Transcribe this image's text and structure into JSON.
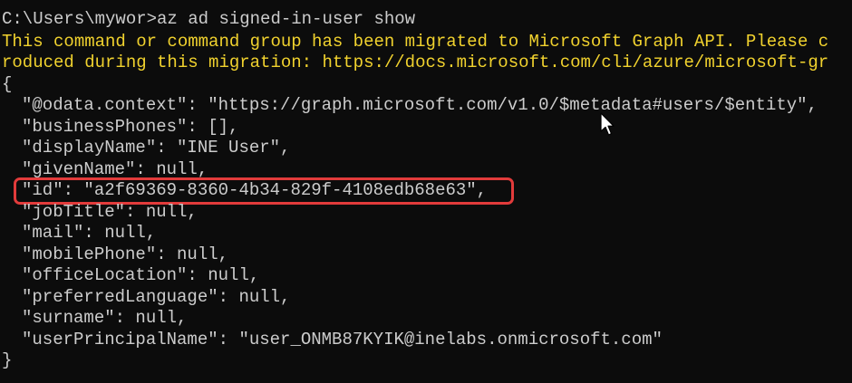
{
  "terminal": {
    "prompt_line": "C:\\Users\\mywor>az ad signed-in-user show",
    "warning_line_1": "This command or command group has been migrated to Microsoft Graph API. Please c",
    "warning_line_2": "roduced during this migration: https://docs.microsoft.com/cli/azure/microsoft-gr",
    "json_open": "{",
    "json_lines": [
      "\"@odata.context\": \"https://graph.microsoft.com/v1.0/$metadata#users/$entity\",",
      "\"businessPhones\": [],",
      "\"displayName\": \"INE User\",",
      "\"givenName\": null,",
      "\"id\": \"a2f69369-8360-4b34-829f-4108edb68e63\",",
      "\"jobTitle\": null,",
      "\"mail\": null,",
      "\"mobilePhone\": null,",
      "\"officeLocation\": null,",
      "\"preferredLanguage\": null,",
      "\"surname\": null,",
      "\"userPrincipalName\": \"user_ONMB87KYIK@inelabs.onmicrosoft.com\""
    ],
    "json_close": "}"
  },
  "colors": {
    "background": "#0c0c0c",
    "text": "#cccccc",
    "warning": "#f1d22e",
    "highlight_border": "#e23b3b"
  },
  "icons": {
    "cursor": "mouse-pointer-icon"
  }
}
